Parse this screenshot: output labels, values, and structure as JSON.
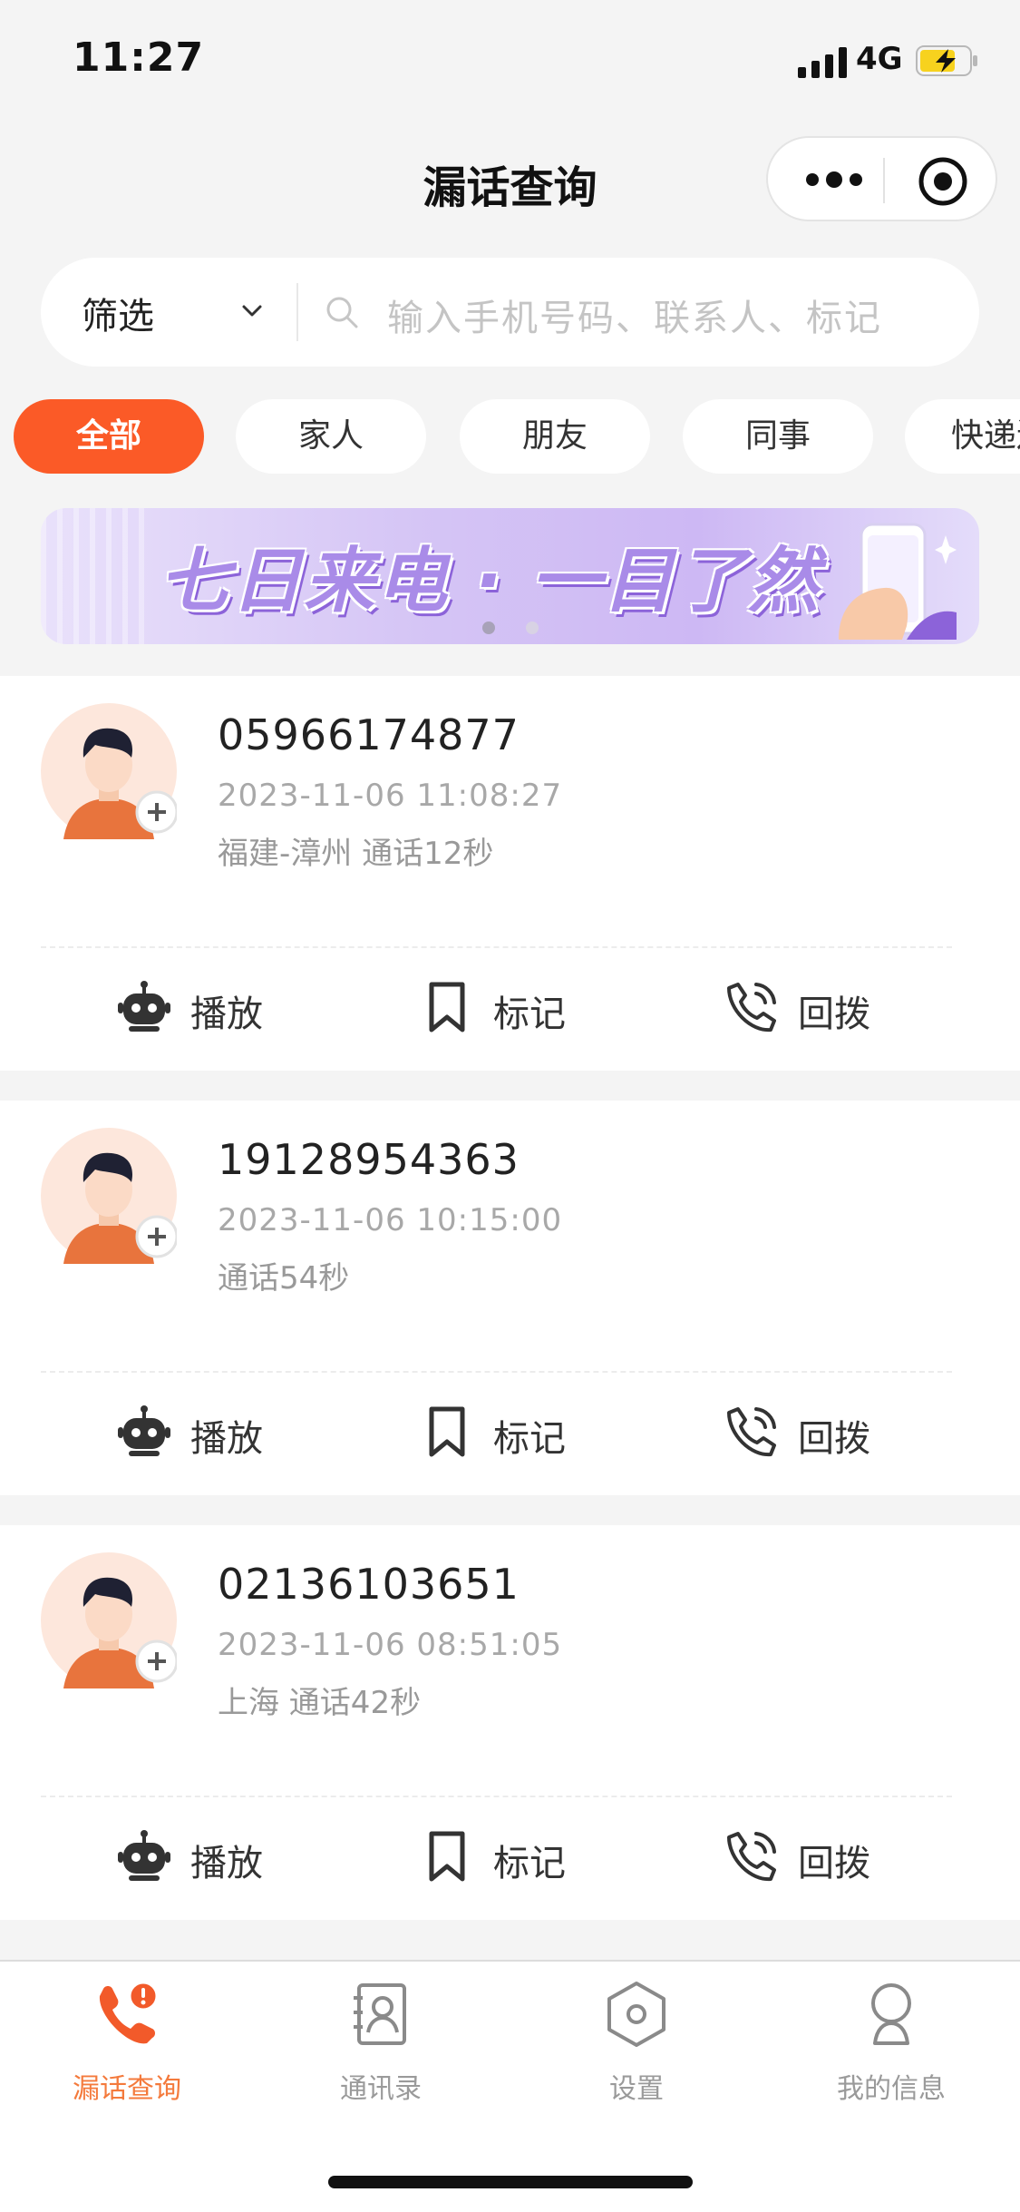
{
  "status": {
    "time": "11:27",
    "network": "4G"
  },
  "nav": {
    "title": "漏话查询"
  },
  "search": {
    "filter_label": "筛选",
    "placeholder": "输入手机号码、联系人、标记"
  },
  "chips": [
    "全部",
    "家人",
    "朋友",
    "同事",
    "快递送"
  ],
  "banner": {
    "text": "七日来电 · 一目了然"
  },
  "calls": [
    {
      "number": "05966174877",
      "time": "2023-11-06 11:08:27",
      "info": "福建-漳州 通话12秒"
    },
    {
      "number": "19128954363",
      "time": "2023-11-06 10:15:00",
      "info": "通话54秒"
    },
    {
      "number": "02136103651",
      "time": "2023-11-06 08:51:05",
      "info": "上海 通话42秒"
    }
  ],
  "actions": {
    "play": "播放",
    "mark": "标记",
    "callback": "回拨"
  },
  "tabs": [
    "漏话查询",
    "通讯录",
    "设置",
    "我的信息"
  ],
  "colors": {
    "accent": "#fb5a27",
    "tab_active": "#f47a3c",
    "banner_purple": "#a98be8"
  },
  "icons": {
    "play": "robot-icon",
    "mark": "bookmark-icon",
    "callback": "phone-callback-icon",
    "tab_missed": "phone-alert-icon",
    "tab_contacts": "contacts-icon",
    "tab_settings": "hexagon-settings-icon",
    "tab_profile": "user-icon"
  }
}
